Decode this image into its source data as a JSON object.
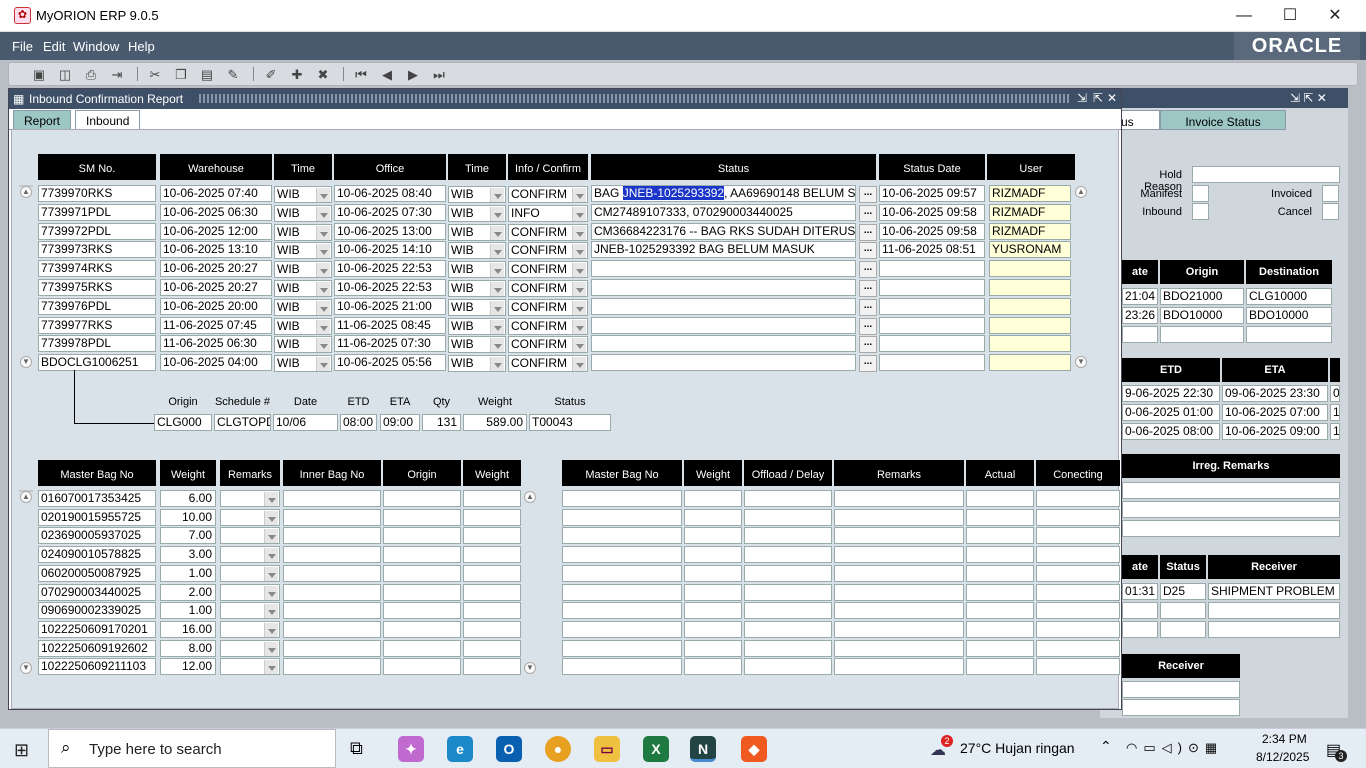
{
  "window": {
    "title": "MyORION ERP 9.0.5",
    "minimize": "—",
    "maximize": "☐",
    "close": "✕"
  },
  "menu": {
    "file": "File",
    "edit": "Edit",
    "window": "Window",
    "help": "Help"
  },
  "brand": "ORACLE",
  "report": {
    "title": "Inbound Confirmation Report",
    "tabs": [
      "Report",
      "Inbound"
    ],
    "headers": [
      "SM No.",
      "Warehouse",
      "Time",
      "Office",
      "Time",
      "Info / Confirm",
      "Status",
      "Status Date",
      "User"
    ],
    "rows": [
      {
        "sm": "7739970RKS",
        "wh": "10-06-2025 07:40",
        "t1": "WIB",
        "office": "10-06-2025 08:40",
        "t2": "WIB",
        "info": "CONFIRM",
        "status_a": "BAG ",
        "status_sel": "JNEB-1025293392",
        "status_b": ", AA69690148 BELUM S",
        "sdate": "10-06-2025 09:57",
        "user": "RIZMADF"
      },
      {
        "sm": "7739971PDL",
        "wh": "10-06-2025 06:30",
        "t1": "WIB",
        "office": "10-06-2025 07:30",
        "t2": "WIB",
        "info": "INFO",
        "status_a": "CM27489107333, 070290003440025",
        "status_sel": "",
        "status_b": "",
        "sdate": "10-06-2025 09:58",
        "user": "RIZMADF"
      },
      {
        "sm": "7739972PDL",
        "wh": "10-06-2025 12:00",
        "t1": "WIB",
        "office": "10-06-2025 13:00",
        "t2": "WIB",
        "info": "CONFIRM",
        "status_a": "CM36684223176 -- BAG RKS SUDAH DITERUS",
        "status_sel": "",
        "status_b": "",
        "sdate": "10-06-2025 09:58",
        "user": "RIZMADF"
      },
      {
        "sm": "7739973RKS",
        "wh": "10-06-2025 13:10",
        "t1": "WIB",
        "office": "10-06-2025 14:10",
        "t2": "WIB",
        "info": "CONFIRM",
        "status_a": "JNEB-1025293392 BAG BELUM MASUK",
        "status_sel": "",
        "status_b": "",
        "sdate": "11-06-2025 08:51",
        "user": "YUSRONAM"
      },
      {
        "sm": "7739974RKS",
        "wh": "10-06-2025 20:27",
        "t1": "WIB",
        "office": "10-06-2025 22:53",
        "t2": "WIB",
        "info": "CONFIRM",
        "status_a": "",
        "status_sel": "",
        "status_b": "",
        "sdate": "",
        "user": ""
      },
      {
        "sm": "7739975RKS",
        "wh": "10-06-2025 20:27",
        "t1": "WIB",
        "office": "10-06-2025 22:53",
        "t2": "WIB",
        "info": "CONFIRM",
        "status_a": "",
        "status_sel": "",
        "status_b": "",
        "sdate": "",
        "user": ""
      },
      {
        "sm": "7739976PDL",
        "wh": "10-06-2025 20:00",
        "t1": "WIB",
        "office": "10-06-2025 21:00",
        "t2": "WIB",
        "info": "CONFIRM",
        "status_a": "",
        "status_sel": "",
        "status_b": "",
        "sdate": "",
        "user": ""
      },
      {
        "sm": "7739977RKS",
        "wh": "11-06-2025 07:45",
        "t1": "WIB",
        "office": "11-06-2025 08:45",
        "t2": "WIB",
        "info": "CONFIRM",
        "status_a": "",
        "status_sel": "",
        "status_b": "",
        "sdate": "",
        "user": ""
      },
      {
        "sm": "7739978PDL",
        "wh": "11-06-2025 06:30",
        "t1": "WIB",
        "office": "11-06-2025 07:30",
        "t2": "WIB",
        "info": "CONFIRM",
        "status_a": "",
        "status_sel": "",
        "status_b": "",
        "sdate": "",
        "user": ""
      },
      {
        "sm": "BDOCLG1006251",
        "wh": "10-06-2025 04:00",
        "t1": "WIB",
        "office": "10-06-2025 05:56",
        "t2": "WIB",
        "info": "CONFIRM",
        "status_a": "",
        "status_sel": "",
        "status_b": "",
        "sdate": "",
        "user": ""
      }
    ],
    "dots": "...",
    "detail": {
      "labels": [
        "Origin",
        "Schedule #",
        "Date",
        "ETD",
        "ETA",
        "Qty",
        "Weight",
        "Status"
      ],
      "values": [
        "CLG000",
        "CLGTOPD",
        "10/06",
        "08:00",
        "09:00",
        "131",
        "589.00",
        "T00043"
      ]
    },
    "bag_left": {
      "headers": [
        "Master Bag No",
        "Weight",
        "Remarks",
        "Inner Bag No",
        "Origin",
        "Weight"
      ],
      "rows": [
        [
          "016070017353425",
          "6.00"
        ],
        [
          "020190015955725",
          "10.00"
        ],
        [
          "023690005937025",
          "7.00"
        ],
        [
          "024090010578825",
          "3.00"
        ],
        [
          "060200050087925",
          "1.00"
        ],
        [
          "070290003440025",
          "2.00"
        ],
        [
          "090690002339025",
          "1.00"
        ],
        [
          "1022250609170201",
          "16.00"
        ],
        [
          "1022250609192602",
          "8.00"
        ],
        [
          "1022250609211103",
          "12.00"
        ]
      ]
    },
    "bag_right": {
      "headers": [
        "Master Bag No",
        "Weight",
        "Offload / Delay",
        "Remarks",
        "Actual",
        "Conecting"
      ]
    }
  },
  "bg": {
    "tabs": [
      "us",
      "Invoice Status"
    ],
    "labels": {
      "hold": "Hold Reason",
      "manifest": "Manifest",
      "invoiced": "Invoiced",
      "inbound": "Inbound",
      "cancel": "Cancel"
    },
    "t1_headers": [
      "ate",
      "Origin",
      "Destination"
    ],
    "t1_rows": [
      [
        "21:04",
        "BDO21000",
        "CLG10000"
      ],
      [
        "23:26",
        "BDO10000",
        "BDO10000"
      ]
    ],
    "t2_headers": [
      "ETD",
      "ETA"
    ],
    "t2_rows": [
      [
        "9-06-2025 22:30",
        "09-06-2025 23:30",
        "0"
      ],
      [
        "0-06-2025 01:00",
        "10-06-2025 07:00",
        "1"
      ],
      [
        "0-06-2025 08:00",
        "10-06-2025 09:00",
        "1"
      ]
    ],
    "irreg": "Irreg. Remarks",
    "t3_headers": [
      "ate",
      "Status",
      "Receiver"
    ],
    "t3_rows": [
      [
        "01:31",
        "D25",
        "SHIPMENT PROBLEM I"
      ]
    ],
    "receiver": "Receiver"
  },
  "taskbar": {
    "search": "Type here to search",
    "weather": "27°C  Hujan ringan",
    "time": "2:34 PM",
    "date": "8/12/2025",
    "badge": "2",
    "notif": "3"
  }
}
